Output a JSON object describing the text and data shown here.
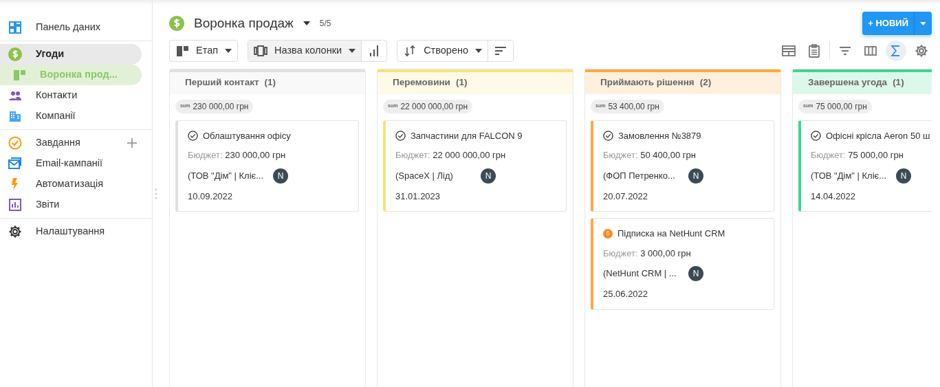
{
  "sidebar": {
    "groups": [
      [
        {
          "kind": "dashboard",
          "label": "Панель даних",
          "selected": false
        }
      ],
      [
        {
          "kind": "dollar",
          "label": "Угоди",
          "selected": true,
          "children": [
            {
              "kind": "board",
              "label": "Воронка прод...",
              "selected": true
            }
          ]
        },
        {
          "kind": "people",
          "label": "Контакти",
          "selected": false
        },
        {
          "kind": "building",
          "label": "Компанії",
          "selected": false
        }
      ],
      [
        {
          "kind": "task",
          "label": "Завдання",
          "selected": false,
          "add": true
        },
        {
          "kind": "mail",
          "label": "Email-кампанії",
          "selected": false
        },
        {
          "kind": "bolt",
          "label": "Автоматизація",
          "selected": false
        },
        {
          "kind": "chart",
          "label": "Звіти",
          "selected": false
        }
      ],
      [
        {
          "kind": "gear",
          "label": "Налаштування",
          "selected": false
        }
      ]
    ]
  },
  "header": {
    "title": "Воронка продаж",
    "count": "5/5",
    "new_button": "+ НОВИЙ"
  },
  "toolbar": {
    "controls": [
      {
        "kind": "stage",
        "label": "Етап"
      },
      {
        "kind": "group",
        "label": "Назва колонки"
      },
      {
        "kind": "sort",
        "label": "Створено"
      }
    ],
    "tools": [
      {
        "kind": "layout",
        "selected": false
      },
      {
        "kind": "clipboard",
        "selected": false
      },
      {
        "kind": "filter",
        "selected": false
      },
      {
        "kind": "grid",
        "selected": false
      },
      {
        "kind": "sigma",
        "selected": true
      },
      {
        "kind": "gear",
        "selected": false
      }
    ]
  },
  "columns": [
    {
      "title": "Перший контакт",
      "count": "(1)",
      "color": "#e0e0e0",
      "sum_label": "sum",
      "sum": "230 000,00 грн",
      "cards": [
        {
          "kind": "done",
          "title": "Облаштування офісу",
          "budget_label": "Бюджет:",
          "budget": "230 000,00 грн",
          "company": "(ТОВ \"Дім\" | Кліє...",
          "avatar": "N",
          "date": "10.09.2022"
        }
      ]
    },
    {
      "title": "Перемовини",
      "count": "(1)",
      "color": "#f7e27a",
      "sum_label": "sum",
      "sum": "22 000 000,00 грн",
      "cards": [
        {
          "kind": "done",
          "title": "Запчастини для FALCON 9",
          "budget_label": "Бюджет:",
          "budget": "22 000 000,00 грн",
          "company": "(SpaceX | Лід)",
          "avatar": "N",
          "date": "31.01.2023"
        }
      ]
    },
    {
      "title": "Приймають рішення",
      "count": "(2)",
      "color": "#ffa940",
      "sum_label": "sum",
      "sum": "53 400,00 грн",
      "cards": [
        {
          "kind": "done",
          "title": "Замовлення №3879",
          "budget_label": "Бюджет:",
          "budget": "50 400,00 грн",
          "company": "(ФОП Петренко...",
          "avatar": "N",
          "date": "20.07.2022"
        },
        {
          "kind": "count",
          "badge": "6",
          "title": "Підписка на NetHunt CRM",
          "budget_label": "Бюджет:",
          "budget": "3 000,00 грн",
          "company": "(NetHunt CRM | ...",
          "avatar": "N",
          "date": "25.06.2022"
        }
      ]
    },
    {
      "title": "Завершена угода",
      "count": "(1)",
      "color": "#3fd68e",
      "sum_label": "sum",
      "sum": "75 000,00 грн",
      "cards": [
        {
          "kind": "done",
          "title": "Офісні крісла Aeron 50 ш",
          "budget_label": "Бюджет:",
          "budget": "75 000,00 грн",
          "company": "(ТОВ \"Дім\" | Кліє...",
          "avatar": "N",
          "date": "14.04.2022"
        }
      ]
    }
  ]
}
